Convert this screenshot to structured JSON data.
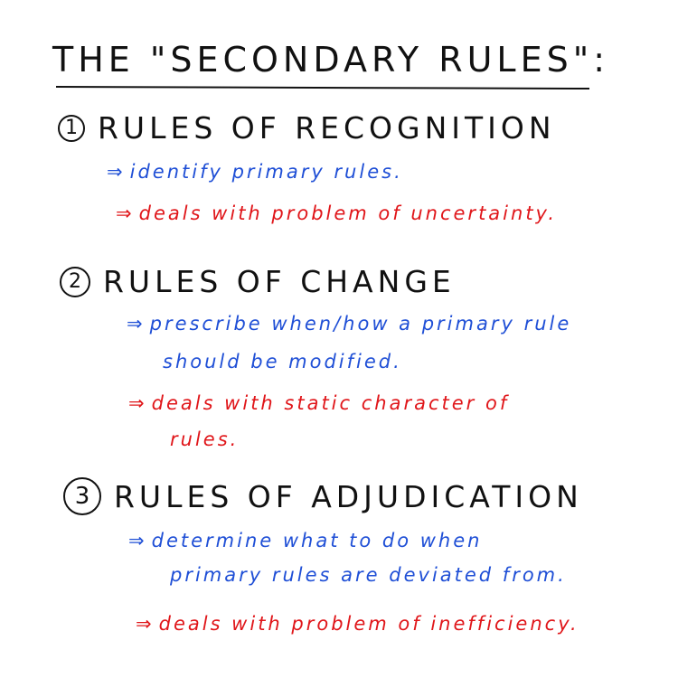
{
  "title": "THE \"SECONDARY RULES\":",
  "arrow_glyph": "⇒",
  "sections": [
    {
      "number": "1",
      "heading": "RULES OF RECOGNITION",
      "blue_note": [
        "identify primary rules."
      ],
      "red_note": [
        "deals with problem of uncertainty."
      ]
    },
    {
      "number": "2",
      "heading": "RULES OF CHANGE",
      "blue_note": [
        "prescribe when/how a primary rule",
        "should be modified."
      ],
      "red_note": [
        "deals with static character of",
        "rules."
      ]
    },
    {
      "number": "3",
      "heading": "RULES OF ADJUDICATION",
      "blue_note": [
        "determine what to do when",
        "primary rules are deviated from."
      ],
      "red_note": [
        "deals with problem of inefficiency."
      ]
    }
  ],
  "colors": {
    "ink": "#111111",
    "blue": "#1f4fd6",
    "red": "#e0161a"
  }
}
